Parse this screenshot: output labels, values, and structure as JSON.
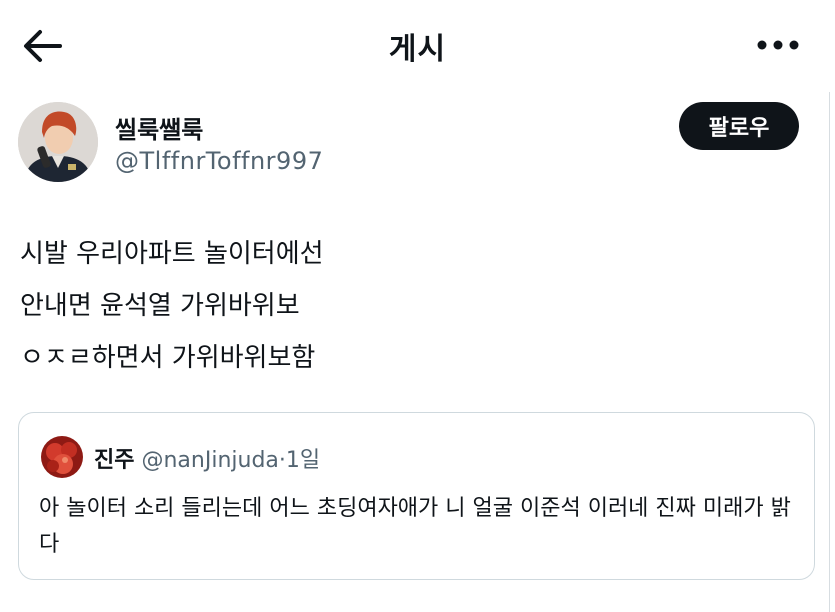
{
  "header": {
    "title": "게시",
    "back_icon": "arrow-left-icon",
    "more_icon": "more-horizontal-icon"
  },
  "author": {
    "display_name": "씰룩쌜룩",
    "handle": "@TlffnrToffnr997",
    "follow_label": "팔로우"
  },
  "tweet": {
    "text": "시발 우리아파트 놀이터에선\n안내면 윤석열 가위바위보\nㅇㅈㄹ하면서 가위바위보함"
  },
  "quote": {
    "name": "진주",
    "handle": "@nanJinjuda",
    "separator": "·",
    "time": "1일",
    "text": "아 놀이터 소리 들리는데 어느 초딩여자애가 니 얼굴 이준석 이러네 진짜 미래가 밝다"
  },
  "colors": {
    "text": "#0f1419",
    "muted": "#536471",
    "follow_bg": "#0f1419",
    "border": "#cfd9de"
  }
}
